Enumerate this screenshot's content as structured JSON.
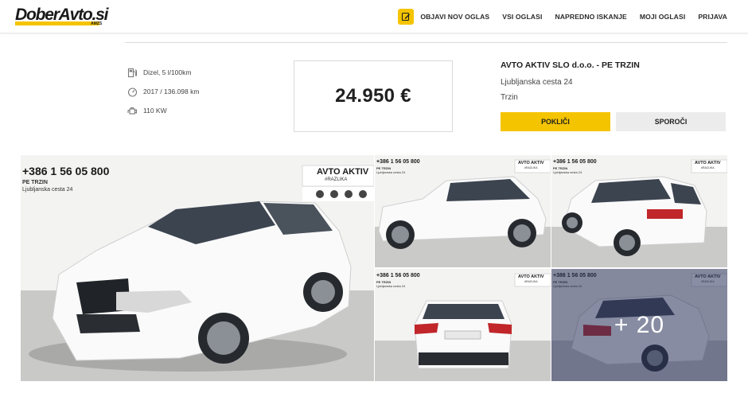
{
  "brand": {
    "logo_text": "DoberAvto.si",
    "logo_sub": "AMZS",
    "accent": "#f5c400"
  },
  "nav": {
    "edit_icon": "edit-icon",
    "items": [
      "OBJAVI NOV OGLAS",
      "VSI OGLASI",
      "NAPREDNO ISKANJE",
      "MOJI OGLASI",
      "PRIJAVA"
    ]
  },
  "specs": [
    {
      "icon": "fuel-pump-icon",
      "text": "Dizel, 5 l/100km"
    },
    {
      "icon": "speedometer-icon",
      "text": "2017 / 136.098 km"
    },
    {
      "icon": "engine-icon",
      "text": "110 KW"
    }
  ],
  "price": "24.950 €",
  "dealer": {
    "name": "AVTO AKTIV SLO d.o.o. - PE TRZIN",
    "street": "Ljubljanska cesta 24",
    "city": "Trzin",
    "call_label": "POKLIČI",
    "message_label": "SPOROČI"
  },
  "gallery": {
    "overlay_phone": "+386 1 56 05 800",
    "overlay_line1": "PE TRZIN",
    "overlay_line2": "Ljubljanska cesta 24",
    "overlay_small_line2": "Ljubljanska cesta 24",
    "banner_title": "AVTO AKTIV",
    "banner_tag": "#RAZLIKA",
    "banner_small_title": "AVTO AKTIV",
    "banner_small_tag": "#RAZLIKA",
    "more_count": "+ 20"
  }
}
